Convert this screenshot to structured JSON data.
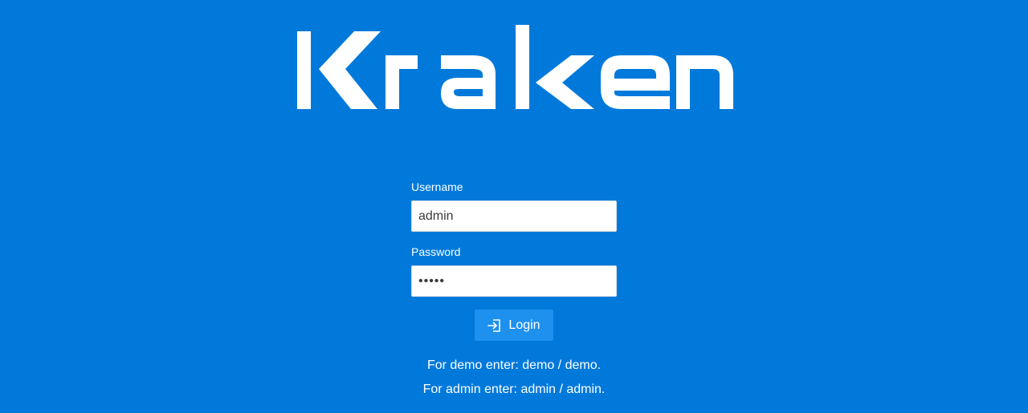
{
  "logo": {
    "text": "Kraken"
  },
  "form": {
    "username": {
      "label": "Username",
      "value": "admin"
    },
    "password": {
      "label": "Password",
      "value": "admin"
    },
    "login_button": {
      "label": "Login",
      "icon": "login-icon"
    }
  },
  "help": {
    "demo_text": "For demo enter: demo / demo.",
    "admin_text": "For admin enter: admin / admin."
  },
  "colors": {
    "background": "#0079db",
    "button": "#1e90ee",
    "text": "#ffffff"
  }
}
